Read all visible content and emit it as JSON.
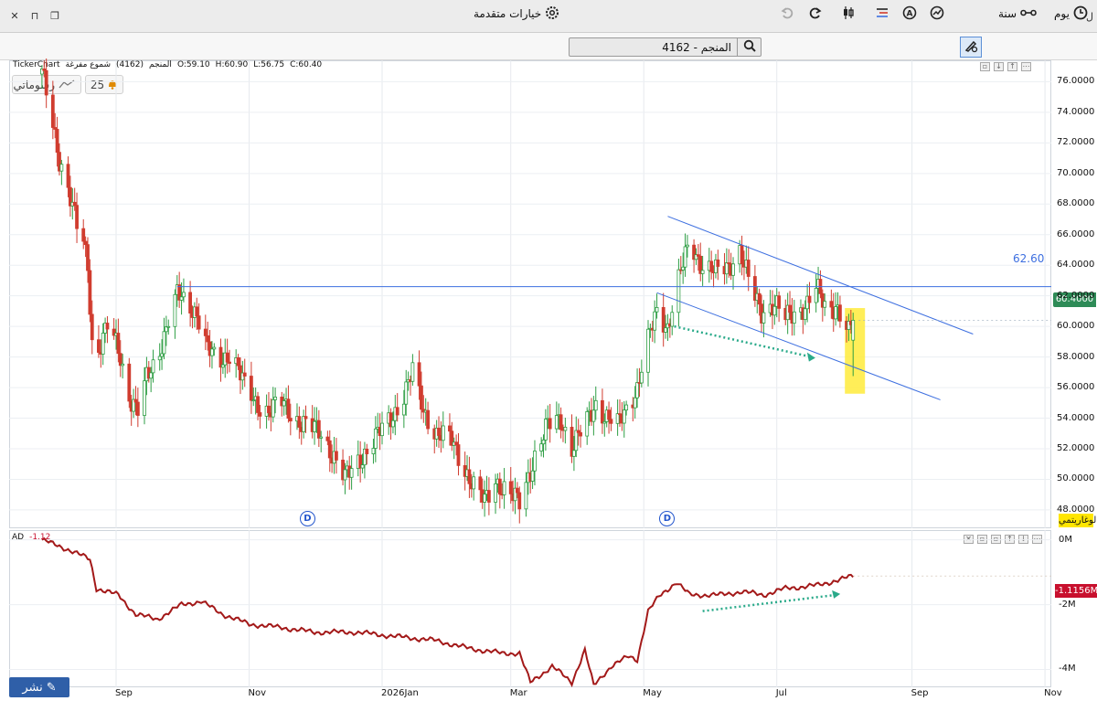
{
  "titlebar": {
    "right_glyph": "ل"
  },
  "toolbar": {
    "day_label": "يوم",
    "year_label": "سنة",
    "search_value": "4162 - المنجم",
    "advanced_options_label": "خيارات متقدمة"
  },
  "legend": {
    "brand": "TickerChart",
    "symbol": "المنجم",
    "code": "(4162)",
    "chart_style": "شموع مفرغة",
    "open": "O:59.10",
    "high": "H:60.90",
    "low": "L:56.75",
    "close": "C:60.40"
  },
  "draw_button_label": "رسوماتي",
  "alert_count": "25",
  "horizontal_line_value": "62.60",
  "last_price": "60.4000",
  "log_label": "لوغاريتمي",
  "ad_indicator": {
    "name": "AD",
    "value": "-1.12",
    "last_value": "-1.1156M"
  },
  "publish_label": "نشر",
  "colors": {
    "up": "#2e9e44",
    "down": "#d03c2f",
    "line": "#3d6fe0",
    "ad_line": "#a31919",
    "highlight": "#ffeb3b",
    "arrow": "#2aaa8a"
  },
  "chart_data": [
    {
      "type": "candlestick",
      "title": "",
      "y_ticks": [
        "76.0000",
        "74.0000",
        "72.0000",
        "70.0000",
        "68.0000",
        "66.0000",
        "64.0000",
        "62.0000",
        "60.0000",
        "58.0000",
        "56.0000",
        "54.0000",
        "52.0000",
        "50.0000",
        "48.0000"
      ],
      "ylim": [
        46.8,
        77.4
      ],
      "x_ticks": [
        "Sep",
        "Nov",
        "2026Jan",
        "Mar",
        "May",
        "Jul",
        "Sep",
        "Nov"
      ],
      "close_path": [
        [
          "2025-07-29",
          76.5
        ],
        [
          "2025-08-02",
          74.0
        ],
        [
          "2025-08-06",
          71.0
        ],
        [
          "2025-08-10",
          69.0
        ],
        [
          "2025-08-14",
          66.5
        ],
        [
          "2025-08-17",
          65.5
        ],
        [
          "2025-08-19",
          64.0
        ],
        [
          "2025-08-21",
          59.0
        ],
        [
          "2025-08-24",
          58.5
        ],
        [
          "2025-08-28",
          60.0
        ],
        [
          "2025-09-02",
          58.5
        ],
        [
          "2025-09-07",
          55.5
        ],
        [
          "2025-09-11",
          54.5
        ],
        [
          "2025-09-15",
          56.5
        ],
        [
          "2025-09-20",
          58.0
        ],
        [
          "2025-09-25",
          60.5
        ],
        [
          "2025-09-29",
          62.0
        ],
        [
          "2025-10-03",
          61.5
        ],
        [
          "2025-10-08",
          61.0
        ],
        [
          "2025-10-13",
          58.5
        ],
        [
          "2025-10-18",
          57.5
        ],
        [
          "2025-10-24",
          58.5
        ],
        [
          "2025-10-30",
          56.0
        ],
        [
          "2025-11-04",
          55.0
        ],
        [
          "2025-11-10",
          54.5
        ],
        [
          "2025-11-16",
          55.0
        ],
        [
          "2025-11-22",
          54.0
        ],
        [
          "2025-11-28",
          53.5
        ],
        [
          "2025-12-04",
          53.0
        ],
        [
          "2025-12-10",
          51.5
        ],
        [
          "2025-12-15",
          50.0
        ],
        [
          "2025-12-20",
          51.0
        ],
        [
          "2025-12-28",
          52.5
        ],
        [
          "2026-01-05",
          54.0
        ],
        [
          "2026-01-11",
          55.5
        ],
        [
          "2026-01-15",
          57.0
        ],
        [
          "2026-01-20",
          54.5
        ],
        [
          "2026-01-26",
          53.0
        ],
        [
          "2026-02-02",
          52.5
        ],
        [
          "2026-02-07",
          51.0
        ],
        [
          "2026-02-12",
          49.5
        ],
        [
          "2026-02-17",
          48.5
        ],
        [
          "2026-02-22",
          50.0
        ],
        [
          "2026-02-28",
          49.0
        ],
        [
          "2026-03-05",
          48.5
        ],
        [
          "2026-03-12",
          51.5
        ],
        [
          "2026-03-18",
          53.5
        ],
        [
          "2026-03-24",
          54.0
        ],
        [
          "2026-03-29",
          52.0
        ],
        [
          "2026-04-04",
          53.5
        ],
        [
          "2026-04-09",
          55.0
        ],
        [
          "2026-04-14",
          54.0
        ],
        [
          "2026-04-19",
          53.5
        ],
        [
          "2026-04-24",
          55.0
        ],
        [
          "2026-04-28",
          56.0
        ],
        [
          "2026-05-03",
          59.0
        ],
        [
          "2026-05-07",
          61.0
        ],
        [
          "2026-05-12",
          60.0
        ],
        [
          "2026-05-17",
          63.0
        ],
        [
          "2026-05-22",
          65.5
        ],
        [
          "2026-05-28",
          64.0
        ],
        [
          "2026-06-03",
          63.5
        ],
        [
          "2026-06-09",
          64.0
        ],
        [
          "2026-06-14",
          65.0
        ],
        [
          "2026-06-19",
          62.5
        ],
        [
          "2026-06-24",
          61.0
        ],
        [
          "2026-06-30",
          61.5
        ],
        [
          "2026-07-05",
          60.5
        ],
        [
          "2026-07-10",
          61.0
        ],
        [
          "2026-07-15",
          61.5
        ],
        [
          "2026-07-19",
          62.5
        ],
        [
          "2026-07-24",
          61.0
        ],
        [
          "2026-07-28",
          61.5
        ],
        [
          "2026-07-31",
          60.5
        ],
        [
          "2026-08-03",
          59.5
        ],
        [
          "2026-08-05",
          60.4
        ]
      ],
      "resistance_line": {
        "value": 62.6,
        "from": "2025-09-29"
      },
      "channel_upper": [
        [
          "2026-05-12",
          67.2
        ],
        [
          "2026-09-29",
          59.5
        ]
      ],
      "channel_lower": [
        [
          "2026-05-07",
          62.2
        ],
        [
          "2026-09-14",
          55.2
        ]
      ],
      "dividend_markers": [
        "2025-11-28",
        "2026-05-12"
      ]
    },
    {
      "type": "line",
      "name": "AD",
      "y_ticks": [
        "0M",
        "-2M",
        "-4M"
      ],
      "ylim": [
        -4.55,
        0.3
      ],
      "values": [
        [
          "2025-07-29",
          0.0
        ],
        [
          "2025-08-10",
          -0.3
        ],
        [
          "2025-08-20",
          -0.6
        ],
        [
          "2025-08-23",
          -1.5
        ],
        [
          "2025-09-02",
          -1.7
        ],
        [
          "2025-09-10",
          -2.3
        ],
        [
          "2025-09-20",
          -2.45
        ],
        [
          "2025-10-01",
          -2.0
        ],
        [
          "2025-10-10",
          -1.9
        ],
        [
          "2025-10-20",
          -2.3
        ],
        [
          "2025-11-01",
          -2.6
        ],
        [
          "2025-11-15",
          -2.7
        ],
        [
          "2025-12-01",
          -2.85
        ],
        [
          "2025-12-20",
          -2.85
        ],
        [
          "2026-01-10",
          -3.0
        ],
        [
          "2026-01-25",
          -3.1
        ],
        [
          "2026-02-10",
          -3.35
        ],
        [
          "2026-02-25",
          -3.5
        ],
        [
          "2026-03-05",
          -3.5
        ],
        [
          "2026-03-10",
          -4.4
        ],
        [
          "2026-03-20",
          -3.9
        ],
        [
          "2026-03-29",
          -4.4
        ],
        [
          "2026-04-04",
          -3.4
        ],
        [
          "2026-04-08",
          -4.5
        ],
        [
          "2026-04-16",
          -3.9
        ],
        [
          "2026-04-24",
          -3.6
        ],
        [
          "2026-04-28",
          -3.7
        ],
        [
          "2026-05-03",
          -2.2
        ],
        [
          "2026-05-08",
          -1.75
        ],
        [
          "2026-05-16",
          -1.3
        ],
        [
          "2026-05-22",
          -1.7
        ],
        [
          "2026-06-05",
          -1.7
        ],
        [
          "2026-06-15",
          -1.6
        ],
        [
          "2026-06-25",
          -1.7
        ],
        [
          "2026-07-05",
          -1.5
        ],
        [
          "2026-07-20",
          -1.4
        ],
        [
          "2026-08-05",
          -1.12
        ]
      ]
    }
  ]
}
